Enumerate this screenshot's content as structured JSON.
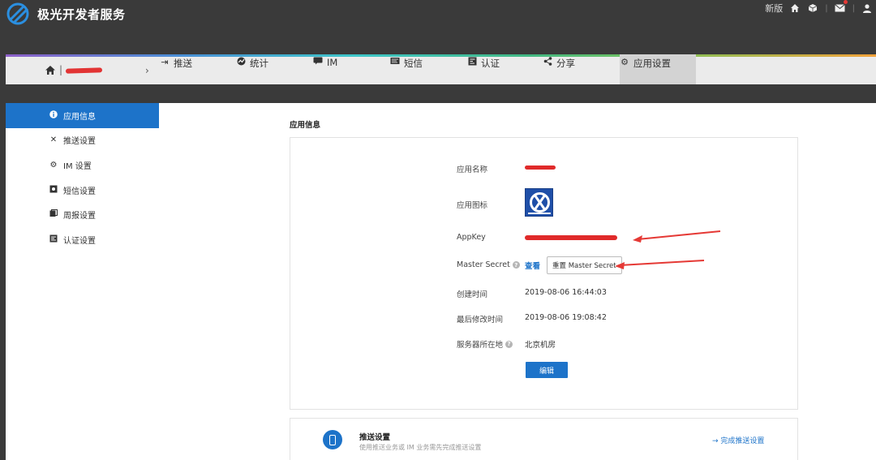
{
  "header": {
    "brand": "极光开发者服务",
    "new_version": "新版",
    "icons": [
      "home-icon",
      "cube-icon",
      "mail-icon",
      "user-icon"
    ]
  },
  "nav": {
    "items": [
      {
        "icon": "login-icon",
        "label": "推送"
      },
      {
        "icon": "stats-icon",
        "label": "统计"
      },
      {
        "icon": "chat-icon",
        "label": "IM"
      },
      {
        "icon": "sms-icon",
        "label": "短信"
      },
      {
        "icon": "verify-icon",
        "label": "认证"
      },
      {
        "icon": "share-icon",
        "label": "分享"
      },
      {
        "icon": "gear-icon",
        "label": "应用设置",
        "active": true
      }
    ]
  },
  "sidebar": {
    "items": [
      {
        "icon": "info-icon",
        "label": "应用信息",
        "active": true
      },
      {
        "icon": "tools-icon",
        "label": "推送设置"
      },
      {
        "icon": "gear-icon",
        "label": "IM 设置"
      },
      {
        "icon": "sms-icon",
        "label": "短信设置"
      },
      {
        "icon": "report-icon",
        "label": "周报设置"
      },
      {
        "icon": "verify-icon",
        "label": "认证设置"
      }
    ]
  },
  "app_info": {
    "section_title": "应用信息",
    "labels": {
      "name": "应用名称",
      "icon": "应用图标",
      "appkey": "AppKey",
      "master_secret": "Master Secret",
      "created": "创建时间",
      "modified": "最后修改时间",
      "server": "服务器所在地"
    },
    "view_link": "查看",
    "reset_button": "重置 Master Secret",
    "created_value": "2019-08-06 16:44:03",
    "modified_value": "2019-08-06 19:08:42",
    "server_value": "北京机房",
    "edit_button": "编辑",
    "colors": {
      "accent": "#1d73c9",
      "annotation": "#e53935"
    }
  },
  "push_card": {
    "title": "推送设置",
    "desc": "使用推送业务或 IM 业务需先完成推送设置",
    "link": "完成推送设置"
  }
}
